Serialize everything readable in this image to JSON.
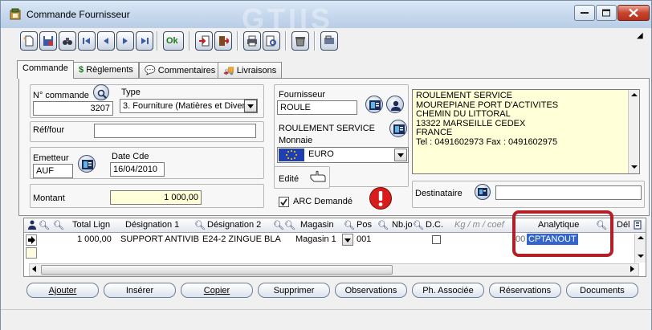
{
  "window": {
    "title": "Commande Fournisseur",
    "watermark": "GTIIS"
  },
  "toolbar": {
    "ok_label": "Ok"
  },
  "tabs": [
    {
      "label": "Commande",
      "icon": "none"
    },
    {
      "label": "Règlements",
      "icon": "dollar-icon"
    },
    {
      "label": "Commentaires",
      "icon": "speech-bubble-icon"
    },
    {
      "label": "Livraisons",
      "icon": "truck-icon"
    }
  ],
  "form": {
    "num_commande": {
      "label": "N° commande",
      "value": "3207"
    },
    "type": {
      "label": "Type",
      "value": "3. Fourniture (Matières et Divers"
    },
    "ref_four": {
      "label": "Réf/four",
      "value": ""
    },
    "emetteur": {
      "label": "Emetteur",
      "value": "AUF"
    },
    "date_cde": {
      "label": "Date Cde",
      "value": "16/04/2010"
    },
    "montant": {
      "label": "Montant",
      "value": "1 000,00"
    },
    "fournisseur": {
      "label": "Fournisseur",
      "value": "ROULE",
      "name": "ROULEMENT SERVICE"
    },
    "monnaie": {
      "label": "Monnaie",
      "value": "EURO"
    },
    "edite": {
      "label": "Edité"
    },
    "arc": {
      "label": "ARC Demandé",
      "checked": true
    },
    "destinataire": {
      "label": "Destinataire",
      "value": ""
    },
    "address_lines": [
      "ROULEMENT SERVICE",
      "MOUREPIANE PORT D'ACTIVITES",
      "CHEMIN DU LITTORAL",
      "13322 MARSEILLE CEDEX",
      "FRANCE",
      "Tel : 0491602973 Fax : 0491602975"
    ]
  },
  "grid": {
    "headers": [
      "Total Lign",
      "Désignation 1",
      "Désignation 2",
      "Magasin",
      "Pos",
      "Nb.jo",
      "D.C.",
      "Kg / m / coef",
      "Analytique",
      "Dél"
    ],
    "row": {
      "total": "1 000,00",
      "designation1": "SUPPORT ANTIVIB",
      "designation2": "E24-2  ZINGUE BLA",
      "magasin": "Magasin 1",
      "pos": "001",
      "kg_prefix": "00",
      "analytique": "CPTANOUT"
    }
  },
  "actions": {
    "ajouter": "Ajouter",
    "inserer": "Insérer",
    "copier": "Copier",
    "supprimer": "Supprimer",
    "observations": "Observations",
    "ph_associee": "Ph. Associée",
    "reservations": "Réservations",
    "documents": "Documents"
  },
  "colors": {
    "highlight_border": "#b41e26",
    "selection": "#3366cc",
    "field_yellow": "#ffffd8"
  }
}
